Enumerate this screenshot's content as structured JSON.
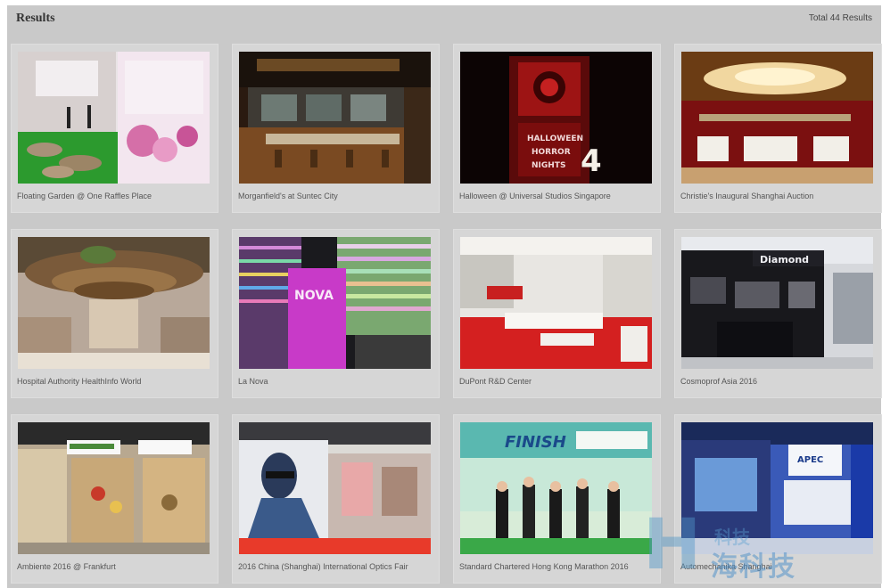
{
  "header": {
    "title": "Results",
    "total": "Total 44 Results"
  },
  "cards": [
    {
      "caption": "Floating Garden @ One Raffles Place",
      "thumb_icon": "floating-garden-photo"
    },
    {
      "caption": "Morganfield's at Suntec City",
      "thumb_icon": "restaurant-interior-photo"
    },
    {
      "caption": "Halloween @ Universal Studios Singapore",
      "thumb_icon": "halloween-tower-photo",
      "sign_text": "HALLOWEEN HORROR NIGHTS 4"
    },
    {
      "caption": "Christie's Inaugural Shanghai Auction",
      "thumb_icon": "auction-hall-photo"
    },
    {
      "caption": "Hospital Authority HealthInfo World",
      "thumb_icon": "atrium-photo"
    },
    {
      "caption": "La Nova",
      "thumb_icon": "building-facade-photo",
      "sign_text": "NOVA"
    },
    {
      "caption": "DuPont R&D Center",
      "thumb_icon": "showroom-photo"
    },
    {
      "caption": "Cosmoprof Asia 2016",
      "thumb_icon": "exhibition-booth-photo",
      "sign_text": "Diamond"
    },
    {
      "caption": "Ambiente 2016 @ Frankfurt",
      "thumb_icon": "trade-fair-stand-photo"
    },
    {
      "caption": "2016 China (Shanghai) International Optics Fair",
      "thumb_icon": "optics-fair-photo"
    },
    {
      "caption": "Standard Chartered Hong Kong Marathon 2016",
      "thumb_icon": "marathon-finish-photo",
      "sign_text": "FINISH"
    },
    {
      "caption": "Automechanika Shanghai",
      "thumb_icon": "blue-booth-photo",
      "sign_text": "APEC"
    }
  ],
  "watermark": {
    "letter": "H",
    "small_text": "科技",
    "text": "海科技"
  },
  "colors": {
    "panel_bg": "#c9c9c9",
    "card_bg": "#d6d6d6",
    "caption": "#555555",
    "watermark": "#5096c8"
  }
}
